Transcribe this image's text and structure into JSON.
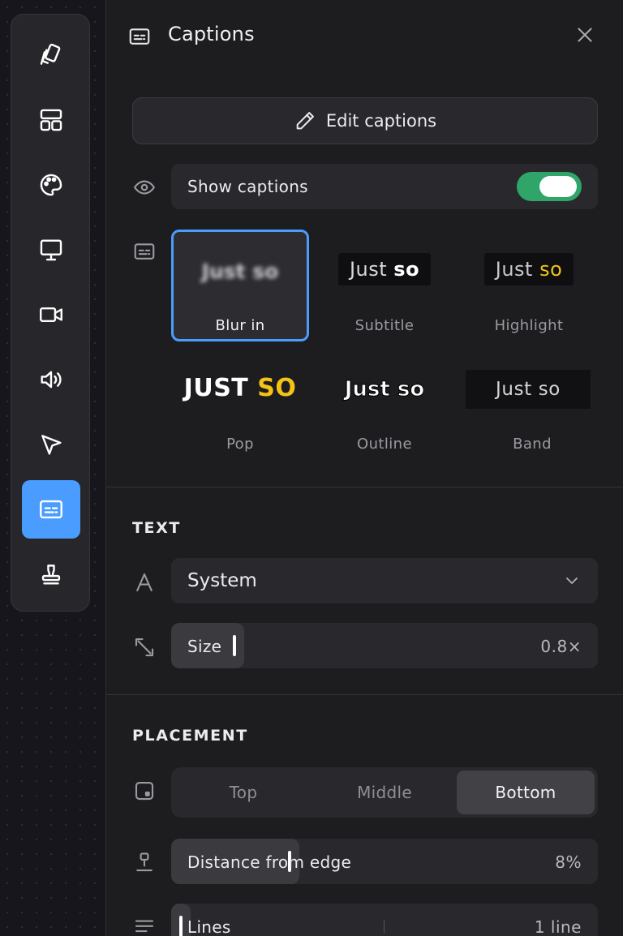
{
  "toolbar": {
    "tools": [
      {
        "name": "cards-icon",
        "active": false
      },
      {
        "name": "layout-icon",
        "active": false
      },
      {
        "name": "palette-icon",
        "active": false
      },
      {
        "name": "monitor-icon",
        "active": false
      },
      {
        "name": "video-camera-icon",
        "active": false
      },
      {
        "name": "speaker-icon",
        "active": false
      },
      {
        "name": "cursor-icon",
        "active": false
      },
      {
        "name": "captions-icon",
        "active": true
      },
      {
        "name": "stamp-icon",
        "active": false
      }
    ],
    "accent": "#4a9dff"
  },
  "panel": {
    "title": "Captions",
    "edit_label": "Edit captions",
    "show_label": "Show captions",
    "show_enabled": true,
    "toggle_color": "#2fa56a"
  },
  "styles": {
    "preview_text": "Just so",
    "pop_preview": {
      "word1": "JUST",
      "word2": "SO"
    },
    "selected": "Blur in",
    "items": [
      {
        "name": "Blur in"
      },
      {
        "name": "Subtitle"
      },
      {
        "name": "Highlight"
      },
      {
        "name": "Pop"
      },
      {
        "name": "Outline"
      },
      {
        "name": "Band"
      }
    ],
    "highlight_color": "#f3c316"
  },
  "text_section": {
    "title": "TEXT",
    "font": "System",
    "size_label": "Size",
    "size_value": "0.8×",
    "size_fraction": 0.15
  },
  "placement_section": {
    "title": "PLACEMENT",
    "options": [
      "Top",
      "Middle",
      "Bottom"
    ],
    "selected": "Bottom",
    "distance_label": "Distance from edge",
    "distance_value": "8%",
    "distance_fraction": 0.3,
    "lines_label": "Lines",
    "lines_value": "1 line",
    "lines_fraction": 0.0
  }
}
